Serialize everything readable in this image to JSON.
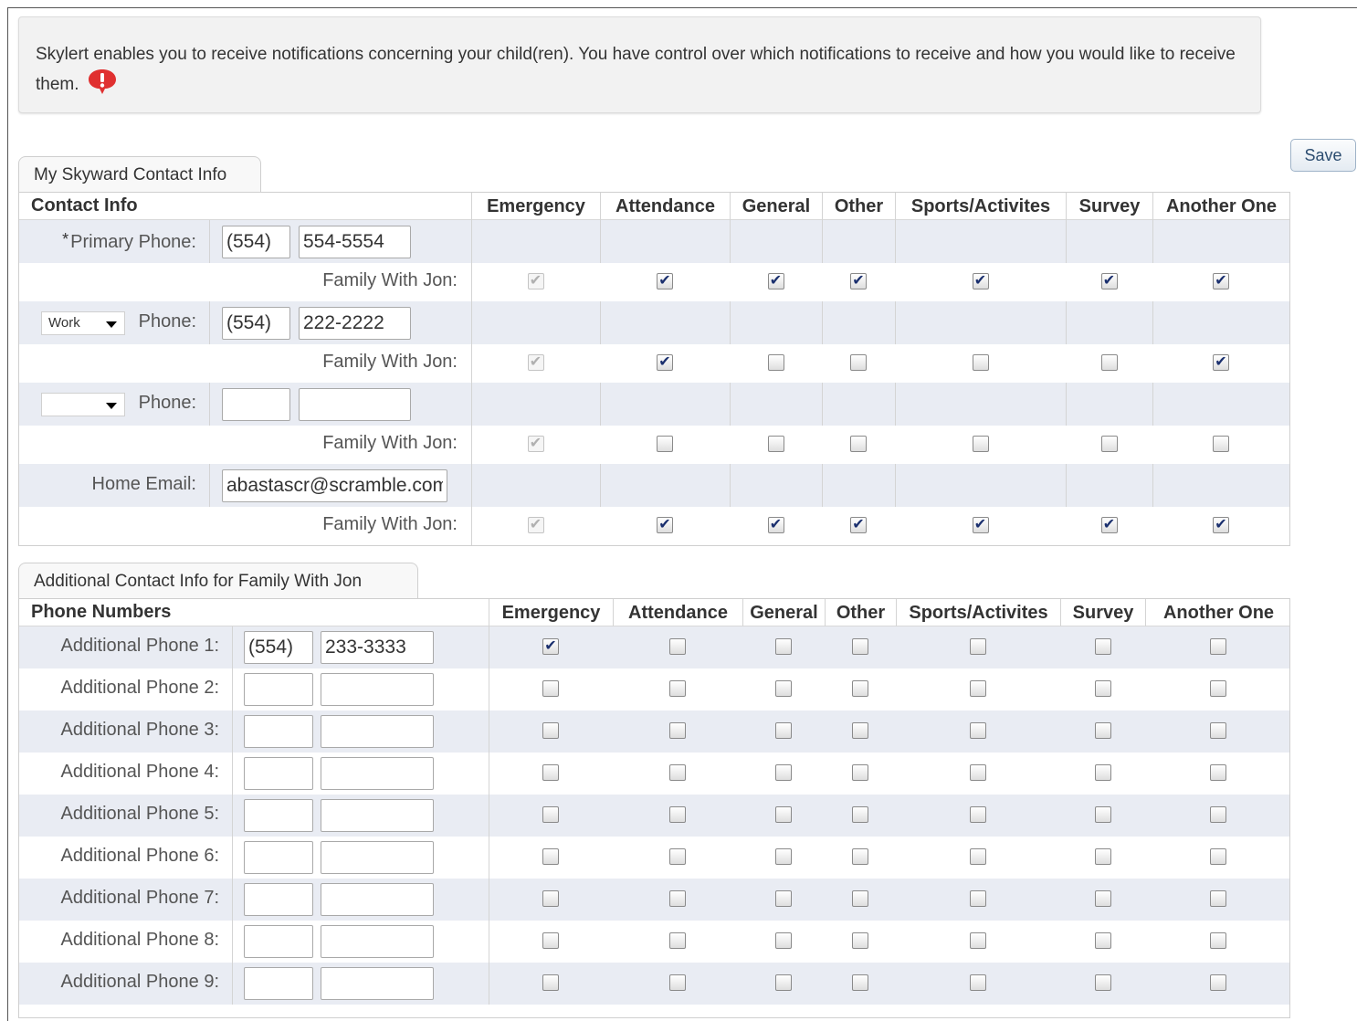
{
  "intro": {
    "text": "Skylert enables you to receive notifications concerning your child(ren). You have control over which notifications to receive and how you would like to receive them."
  },
  "save_label": "Save",
  "colors": {
    "row_shade": "#e9ecf3",
    "checkmark": "#1a2f6e",
    "alert_icon": "#e03030"
  },
  "section1": {
    "tab_label": "My Skyward Contact Info",
    "header_title": "Contact Info",
    "columns": [
      "Emergency",
      "Attendance",
      "General",
      "Other",
      "Sports/Activites",
      "Survey",
      "Another One"
    ],
    "rows": [
      {
        "kind": "contact",
        "required_mark": "*",
        "label": "Primary Phone:",
        "area": "(554)",
        "number": "554-5554"
      },
      {
        "kind": "family",
        "label": "Family With Jon:",
        "checks": [
          true,
          true,
          true,
          true,
          true,
          true,
          true
        ]
      },
      {
        "kind": "contact",
        "select": "Work",
        "label": "Phone:",
        "area": "(554)",
        "number": "222-2222"
      },
      {
        "kind": "family",
        "label": "Family With Jon:",
        "checks": [
          true,
          true,
          false,
          false,
          false,
          false,
          true
        ]
      },
      {
        "kind": "contact",
        "select": "",
        "label": "Phone:",
        "area": "",
        "number": ""
      },
      {
        "kind": "family",
        "label": "Family With Jon:",
        "checks": [
          true,
          false,
          false,
          false,
          false,
          false,
          false
        ]
      },
      {
        "kind": "email",
        "label": "Home Email:",
        "email": "abastascr@scramble.com"
      },
      {
        "kind": "family",
        "label": "Family With Jon:",
        "checks": [
          true,
          true,
          true,
          true,
          true,
          true,
          true
        ]
      }
    ]
  },
  "section2": {
    "tab_label": "Additional Contact Info for Family With Jon",
    "header_title": "Phone Numbers",
    "columns": [
      "Emergency",
      "Attendance",
      "General",
      "Other",
      "Sports/Activites",
      "Survey",
      "Another One"
    ],
    "rows": [
      {
        "label": "Additional Phone 1:",
        "area": "(554)",
        "number": "233-3333",
        "checks": [
          true,
          false,
          false,
          false,
          false,
          false,
          false
        ]
      },
      {
        "label": "Additional Phone 2:",
        "area": "",
        "number": "",
        "checks": [
          false,
          false,
          false,
          false,
          false,
          false,
          false
        ]
      },
      {
        "label": "Additional Phone 3:",
        "area": "",
        "number": "",
        "checks": [
          false,
          false,
          false,
          false,
          false,
          false,
          false
        ]
      },
      {
        "label": "Additional Phone 4:",
        "area": "",
        "number": "",
        "checks": [
          false,
          false,
          false,
          false,
          false,
          false,
          false
        ]
      },
      {
        "label": "Additional Phone 5:",
        "area": "",
        "number": "",
        "checks": [
          false,
          false,
          false,
          false,
          false,
          false,
          false
        ]
      },
      {
        "label": "Additional Phone 6:",
        "area": "",
        "number": "",
        "checks": [
          false,
          false,
          false,
          false,
          false,
          false,
          false
        ]
      },
      {
        "label": "Additional Phone 7:",
        "area": "",
        "number": "",
        "checks": [
          false,
          false,
          false,
          false,
          false,
          false,
          false
        ]
      },
      {
        "label": "Additional Phone 8:",
        "area": "",
        "number": "",
        "checks": [
          false,
          false,
          false,
          false,
          false,
          false,
          false
        ]
      },
      {
        "label": "Additional Phone 9:",
        "area": "",
        "number": "",
        "checks": [
          false,
          false,
          false,
          false,
          false,
          false,
          false
        ]
      }
    ]
  }
}
